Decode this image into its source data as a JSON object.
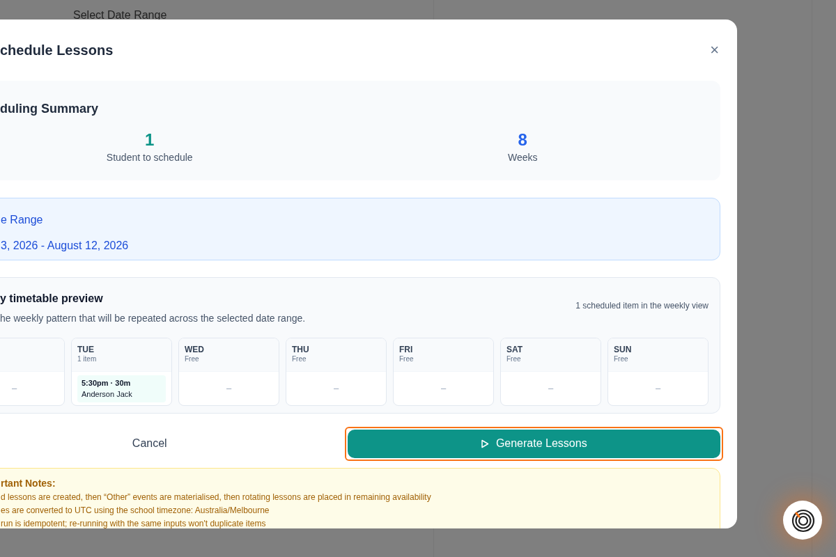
{
  "background": {
    "heading": "Select Date Range"
  },
  "modal": {
    "title": "chedule Lessons",
    "close": "×",
    "summary": {
      "title": "duling Summary",
      "stats": [
        {
          "value": "1",
          "label": "Student to schedule",
          "color": "#0d9488"
        },
        {
          "value": "8",
          "label": "Weeks",
          "color": "#2563eb"
        }
      ]
    },
    "date_range": {
      "title": "e Range",
      "value": "3, 2026 - August 12, 2026"
    },
    "timetable": {
      "title": "y timetable preview",
      "subtitle": "he weekly pattern that will be repeated across the selected date range.",
      "count": "1 scheduled item in the weekly view",
      "days": [
        {
          "empty": "–"
        },
        {
          "name": "TUE",
          "status": "1 item",
          "items": [
            {
              "time": "5:30pm · 30m",
              "student": "Anderson Jack"
            }
          ]
        },
        {
          "name": "WED",
          "status": "Free",
          "empty": "–"
        },
        {
          "name": "THU",
          "status": "Free",
          "empty": "–"
        },
        {
          "name": "FRI",
          "status": "Free",
          "empty": "–"
        },
        {
          "name": "SAT",
          "status": "Free",
          "empty": "–"
        },
        {
          "name": "SUN",
          "status": "Free",
          "empty": "–"
        }
      ]
    },
    "actions": {
      "cancel": "Cancel",
      "generate": "Generate Lessons",
      "generate_focused": true
    },
    "notes": {
      "title": "rtant Notes:",
      "lines": [
        "d lessons are created, then “Other” events are materialised, then rotating lessons are placed in remaining availability",
        "es are converted to UTC using the school timezone: Australia/Melbourne",
        "run is idempotent; re-running with the same inputs won't duplicate items"
      ]
    }
  }
}
